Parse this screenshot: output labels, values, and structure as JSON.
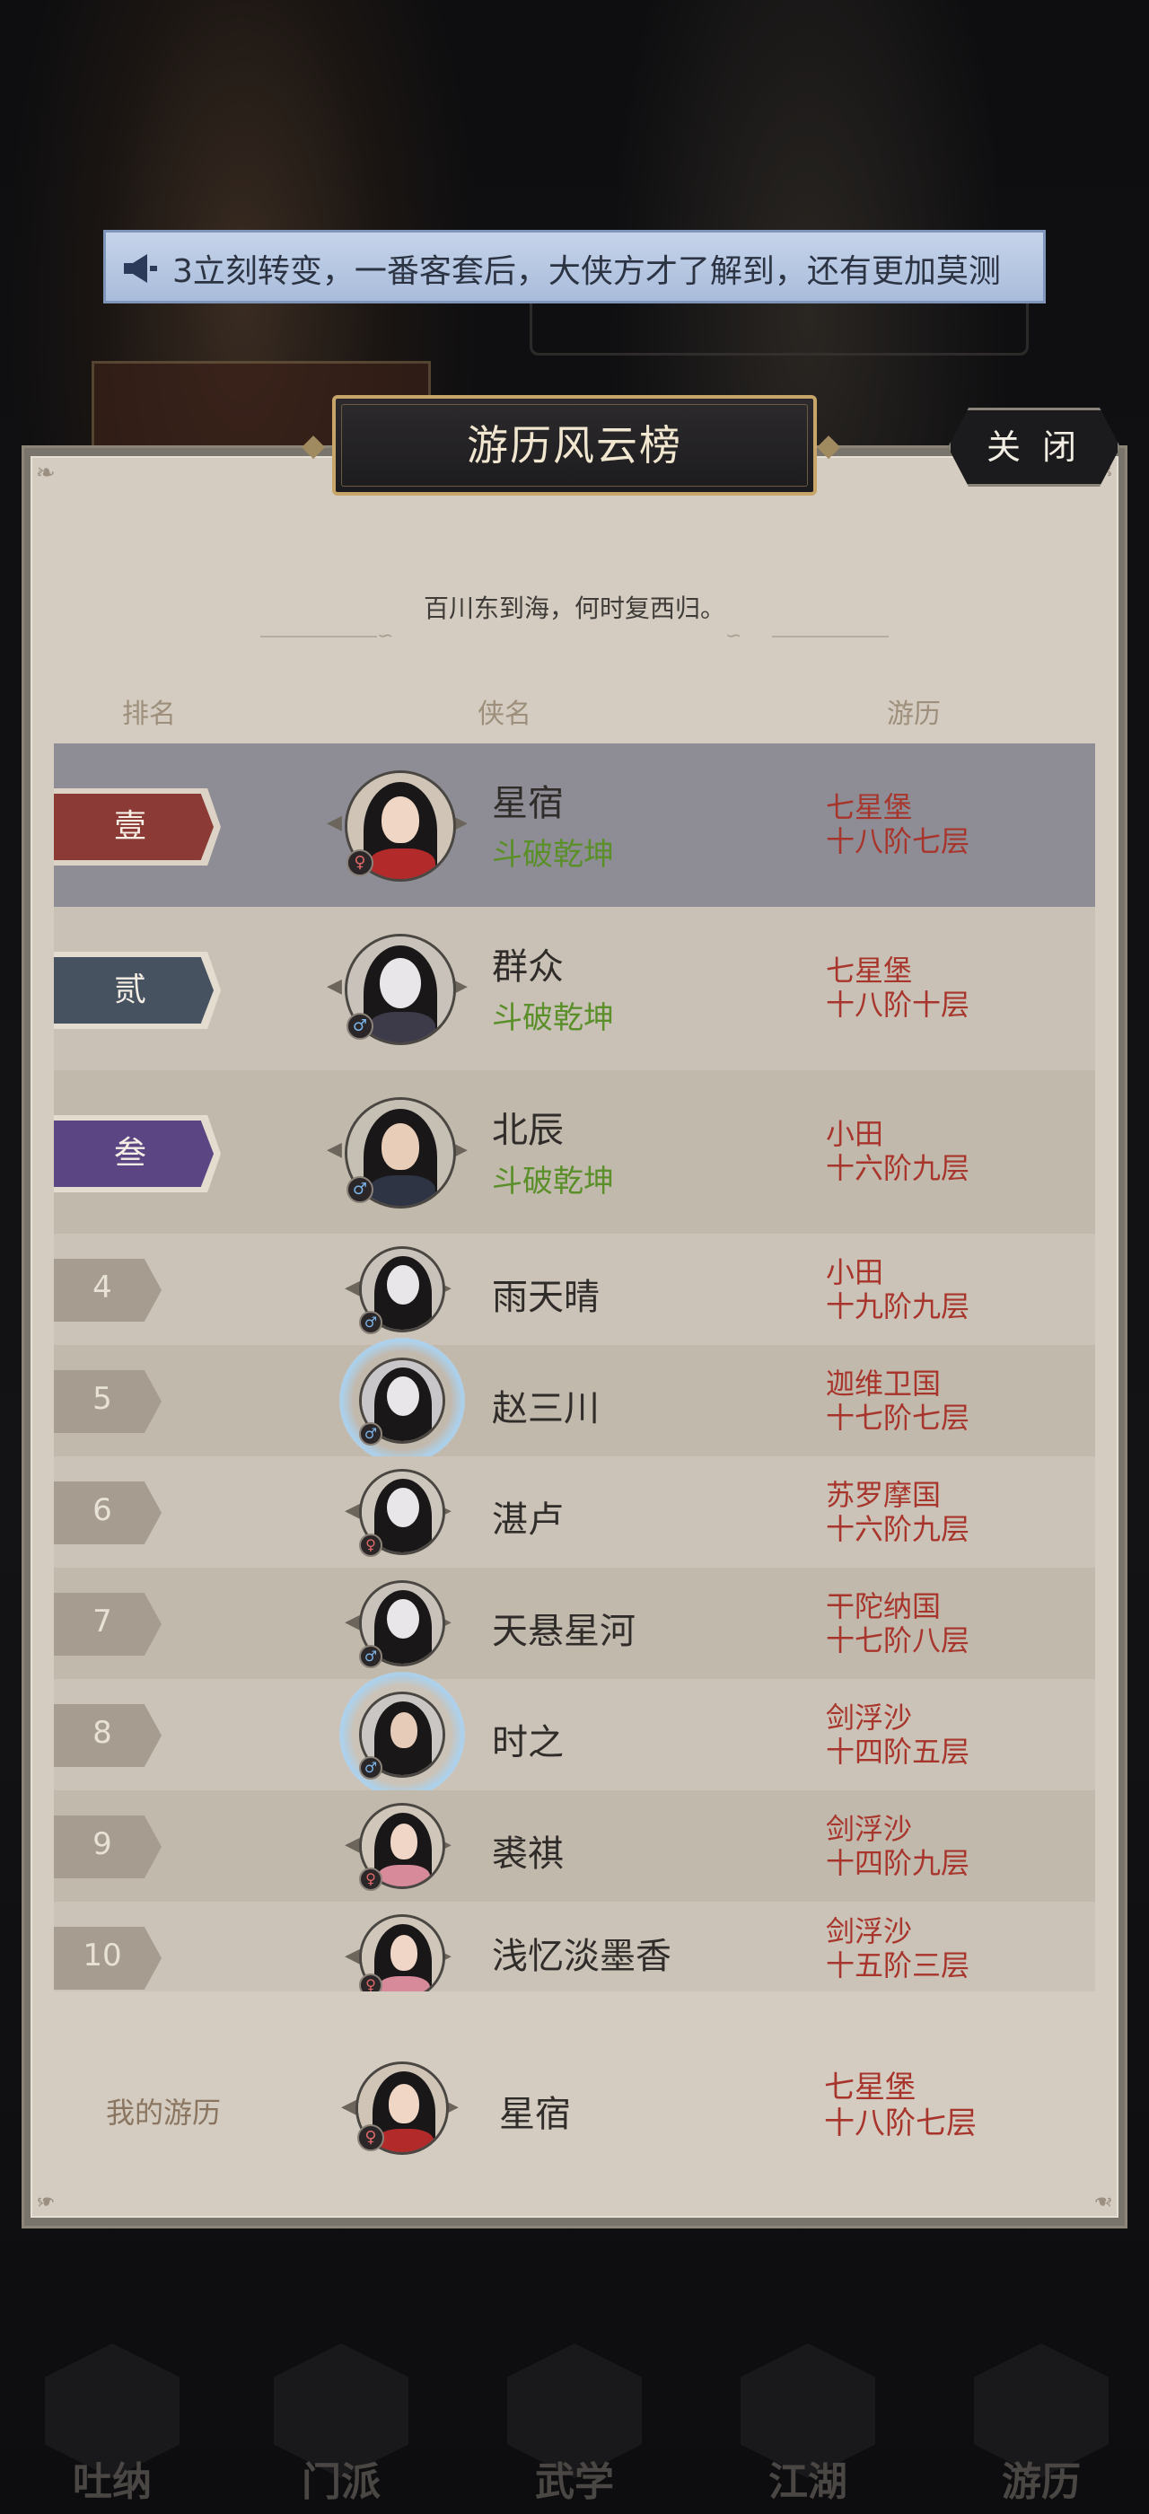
{
  "marquee": {
    "text": "3立刻转变，一番客套后，大侠方才了解到，还有更加莫测",
    "icon": "megaphone-icon"
  },
  "panel": {
    "title": "游历风云榜",
    "close_label": "关 闭",
    "subtitle": "百川东到海，何时复西归。",
    "columns": {
      "rank": "排名",
      "hero": "侠名",
      "progress": "游历"
    }
  },
  "ranking": [
    {
      "rank": "壹",
      "name": "星宿",
      "title": "斗破乾坤",
      "place": "七星堡",
      "level": "十八阶七层",
      "gender": "female"
    },
    {
      "rank": "贰",
      "name": "群众",
      "title": "斗破乾坤",
      "place": "七星堡",
      "level": "十八阶十层",
      "gender": "male"
    },
    {
      "rank": "叁",
      "name": "北辰",
      "title": "斗破乾坤",
      "place": "小田",
      "level": "十六阶九层",
      "gender": "male"
    },
    {
      "rank": "4",
      "name": "雨天晴",
      "place": "小田",
      "level": "十九阶九层",
      "gender": "male"
    },
    {
      "rank": "5",
      "name": "赵三川",
      "place": "迦维卫国",
      "level": "十七阶七层",
      "gender": "male"
    },
    {
      "rank": "6",
      "name": "湛卢",
      "place": "苏罗摩国",
      "level": "十六阶九层",
      "gender": "female"
    },
    {
      "rank": "7",
      "name": "天悬星河",
      "place": "干陀纳国",
      "level": "十七阶八层",
      "gender": "male"
    },
    {
      "rank": "8",
      "name": "时之",
      "place": "剑浮沙",
      "level": "十四阶五层",
      "gender": "male"
    },
    {
      "rank": "9",
      "name": "裘祺",
      "place": "剑浮沙",
      "level": "十四阶九层",
      "gender": "female"
    },
    {
      "rank": "10",
      "name": "浅忆淡墨香",
      "place": "剑浮沙",
      "level": "十五阶三层",
      "gender": "female"
    }
  ],
  "my_record": {
    "label": "我的游历",
    "name": "星宿",
    "place": "七星堡",
    "level": "十八阶七层"
  },
  "bottom_nav": [
    {
      "label": "吐纳"
    },
    {
      "label": "门派"
    },
    {
      "label": "武学"
    },
    {
      "label": "江湖"
    },
    {
      "label": "游历"
    }
  ],
  "colors": {
    "rank1_bg": "#8e8d95",
    "rank1_banner": "#8b3a36",
    "rank2_banner": "#465260",
    "rank3_banner": "#5c4583",
    "place_text": "#a8352c",
    "title_text": "#5a8f2a"
  }
}
